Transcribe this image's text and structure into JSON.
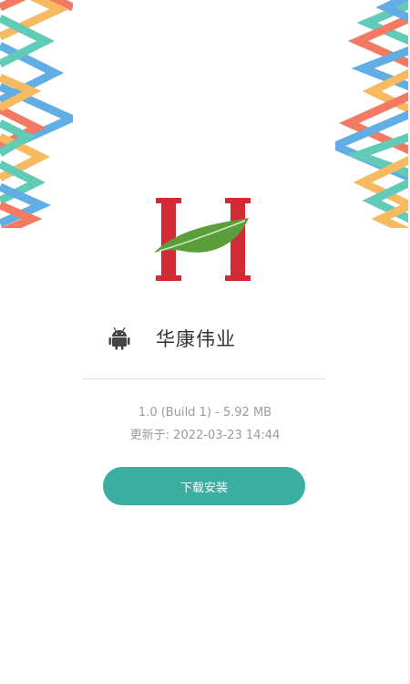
{
  "app": {
    "name": "华康伟业",
    "platform_icon": "android-icon"
  },
  "build": {
    "version_text": "1.0 (Build 1) - 5.92 MB",
    "updated_text": "更新于: 2022-03-23 14:44"
  },
  "actions": {
    "download_label": "下载安装"
  },
  "colors": {
    "accent": "#3aaea1",
    "logo_red": "#d22b33",
    "logo_green": "#5a9e3a",
    "decor_red": "#f05a3c",
    "decor_orange": "#f7a93a",
    "decor_blue": "#3b99dd",
    "decor_teal": "#3bbfa6"
  }
}
